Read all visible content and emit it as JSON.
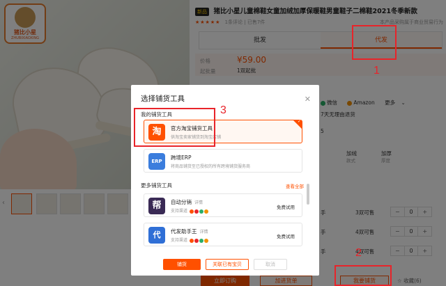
{
  "product": {
    "logo_text": "猪比小星",
    "logo_sub": "ZHUBIXIAOXING",
    "new_tag": "新品",
    "title": "猪比小星儿童棉鞋女童加绒加厚保暖鞋男童鞋子二棉鞋2021冬季新款",
    "rating_stars": "★★★★★",
    "reviews": "1条评论",
    "sales": "已售7件",
    "store_note": "本产品采购属于商业贸易行为"
  },
  "tabs": [
    {
      "label": "批发"
    },
    {
      "label": "代发"
    }
  ],
  "price": {
    "price_label": "价格",
    "price_value": "¥59.00",
    "moq_label": "起批量",
    "moq_value": "1双起批"
  },
  "share": {
    "wechat": "微信",
    "amazon": "Amazon",
    "more": "更多",
    "return_policy": "7天无理由退货",
    "return_suffix": "5"
  },
  "spec": {
    "col_jia_rong": "加绒",
    "col_jia_hou": "加厚",
    "sub_kuanshi": "款式",
    "sub_houdu": "厚度",
    "rows": [
      {
        "label": "手",
        "stock": "3双可售",
        "qty": "0"
      },
      {
        "label": "手",
        "stock": "4双可售",
        "qty": "0"
      },
      {
        "label": "手",
        "stock": "4双可售",
        "qty": "0"
      }
    ]
  },
  "actions": {
    "buy_now": "立即订购",
    "add_cart": "加进货单",
    "bulk_dropship": "我要铺货",
    "favorite": "收藏(6)"
  },
  "dialog": {
    "title": "选择铺货工具",
    "my_tools_label": "我的铺货工具",
    "more_tools_label": "更多铺货工具",
    "view_all": "查看全部",
    "tools": [
      {
        "icon": "淘",
        "name": "官方淘宝铺货工具",
        "desc": "供淘宝卖家铺货到淘宝店铺",
        "color": "#ff5000"
      },
      {
        "icon": "ERP",
        "name": "跨境ERP",
        "desc": "将商品铺货至已授权的所有跨境铺货服务商",
        "color": "#3b7ddd"
      }
    ],
    "more_tools": [
      {
        "icon": "帮",
        "name": "自动分销",
        "tag": "详情",
        "support": "支持渠道",
        "action": "免费试用",
        "color": "#3a2a55"
      },
      {
        "icon": "代",
        "name": "代发助手王",
        "tag": "详情",
        "support": "支持渠道",
        "action": "免费试用",
        "color": "#2f6fd6"
      }
    ],
    "btn_confirm": "铺货",
    "btn_link": "关联已有宝贝",
    "btn_cancel": "取消"
  },
  "annotations": {
    "n1": "1",
    "n2": "2",
    "n3": "3"
  }
}
